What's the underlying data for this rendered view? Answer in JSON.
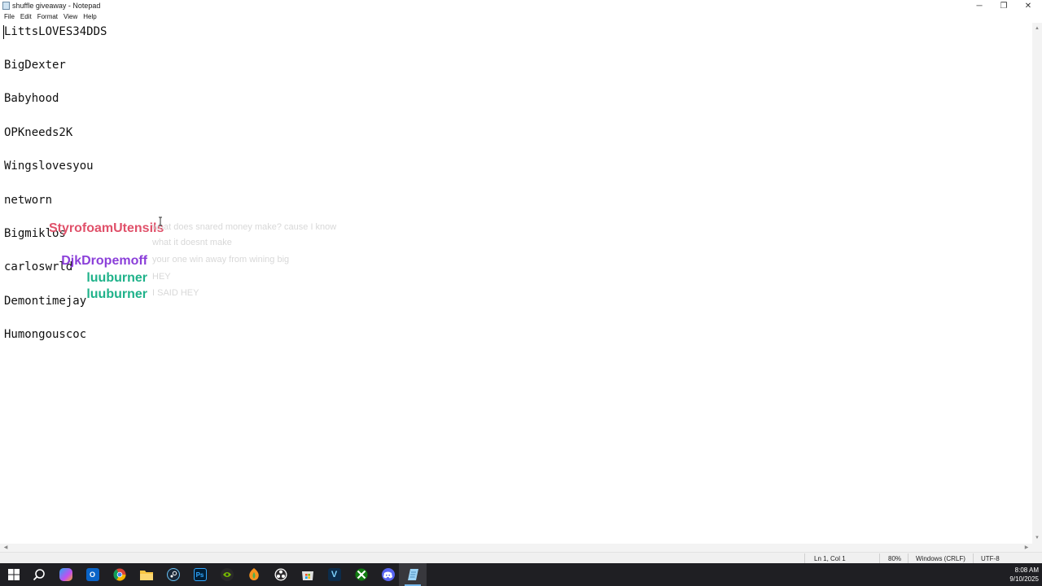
{
  "window": {
    "title": "shuffle giveaway - Notepad",
    "controls": {
      "minimize": "─",
      "restore": "❐",
      "close": "✕"
    }
  },
  "menu": [
    "File",
    "Edit",
    "Format",
    "View",
    "Help"
  ],
  "editor": {
    "lines": [
      "LittsLOVES34DDS",
      "BigDexter",
      "Babyhood",
      "OPKneeds2K",
      "Wingslovesyou",
      "networn",
      "Bigmiklos",
      "carloswrld",
      "Demontimejay",
      "Humongouscoc"
    ]
  },
  "chat": [
    {
      "user": "StyrofoamUtensils",
      "color": "#e0516a",
      "message": "what does snared money make? cause I know",
      "message2": "what it doesnt make"
    },
    {
      "user": "DjkDropemoff",
      "color": "#8b3fd9",
      "message": "your one win away from wining big"
    },
    {
      "user": "luuburner",
      "color": "#1fb28a",
      "message": "HEY"
    },
    {
      "user": "luuburner",
      "color": "#1fb28a",
      "message": "I SAID HEY"
    }
  ],
  "status": {
    "position": "Ln 1, Col 1",
    "zoom": "80%",
    "line_ending": "Windows (CRLF)",
    "encoding": "UTF-8"
  },
  "taskbar": {
    "icons": [
      "windows-start",
      "search",
      "copilot",
      "outlook",
      "chrome",
      "file-explorer",
      "steam",
      "photoshop",
      "nvidia",
      "fl-studio",
      "obs",
      "microsoft-store",
      "vegas",
      "xbox",
      "discord",
      "notepad"
    ],
    "labels": {
      "photoshop": "Ps",
      "vegas": "V"
    },
    "time": "8:08 AM",
    "date": "9/10/2025"
  }
}
